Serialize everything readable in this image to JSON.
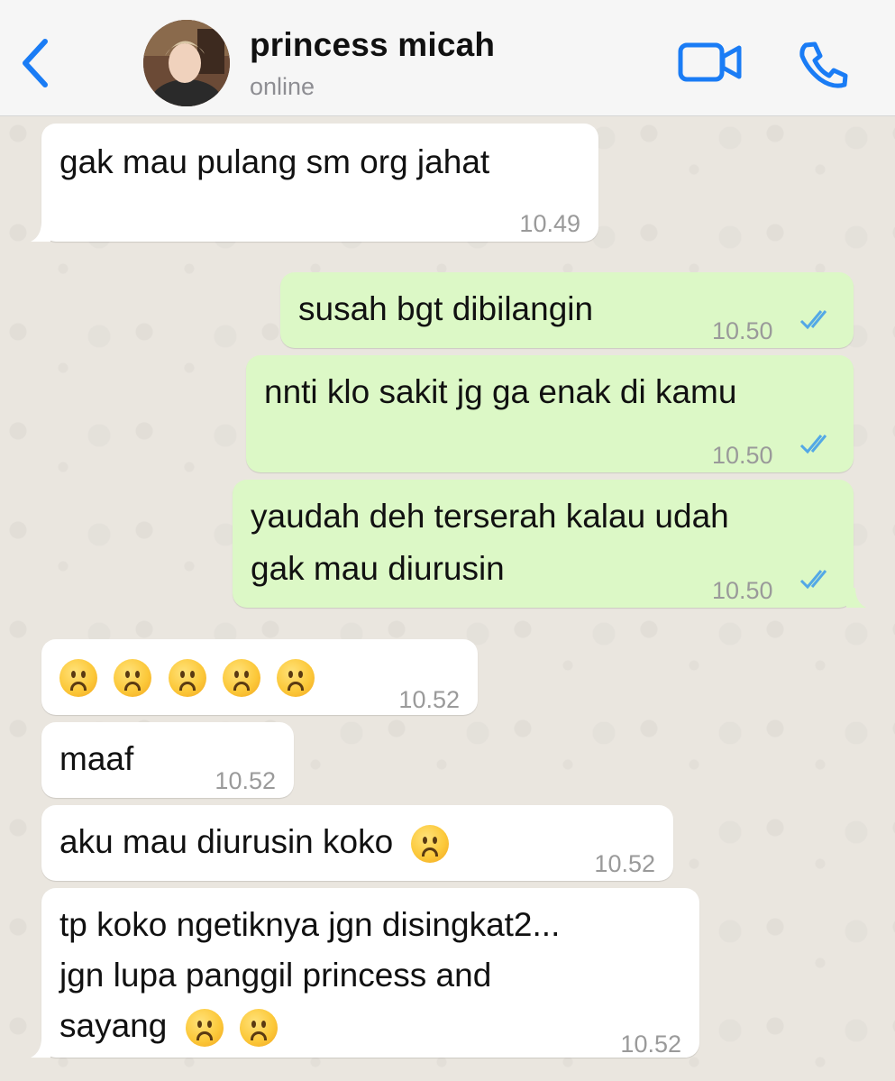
{
  "header": {
    "contact_name": "princess micah",
    "status": "online",
    "accent_color": "#1a7cf5"
  },
  "messages": [
    {
      "direction": "incoming",
      "text": "gak mau pulang sm org jahat",
      "time": "10.49"
    },
    {
      "direction": "outgoing",
      "text": "susah bgt dibilangin",
      "time": "10.50",
      "read": true
    },
    {
      "direction": "outgoing",
      "text": "nnti klo sakit jg ga enak di kamu",
      "time": "10.50",
      "read": true
    },
    {
      "direction": "outgoing",
      "lines": [
        "yaudah deh terserah kalau udah",
        "gak mau diurusin"
      ],
      "time": "10.50",
      "read": true
    },
    {
      "direction": "incoming",
      "emoji_count": 5,
      "emoji": "frowning-face",
      "time": "10.52"
    },
    {
      "direction": "incoming",
      "text": "maaf",
      "time": "10.52"
    },
    {
      "direction": "incoming",
      "text": "aku mau diurusin koko",
      "emoji": "frowning-face",
      "time": "10.52"
    },
    {
      "direction": "incoming",
      "lines": [
        "tp koko ngetiknya jgn disingkat2...",
        "jgn lupa panggil princess and",
        "sayang"
      ],
      "emoji_count": 2,
      "emoji": "frowning-face",
      "time": "10.52"
    }
  ],
  "colors": {
    "incoming_bubble": "#ffffff",
    "outgoing_bubble": "#dcf8c6",
    "read_tick": "#53a8e6"
  },
  "icons": [
    "back-chevron-icon",
    "video-call-icon",
    "phone-icon",
    "double-check-icon",
    "frowning-face-icon"
  ]
}
